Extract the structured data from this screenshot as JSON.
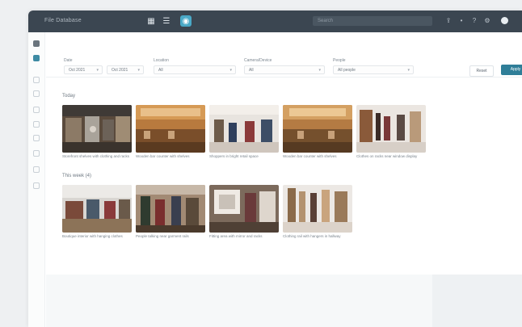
{
  "app": {
    "title": "File Database"
  },
  "toolbar": {
    "search_placeholder": "Search",
    "icons": [
      "grid-icon",
      "list-icon",
      "map-pin-icon"
    ]
  },
  "filters": {
    "date": {
      "label": "Date",
      "value_from": "Oct 2021",
      "value_to": "Oct 2021"
    },
    "location": {
      "label": "Location",
      "value": "All"
    },
    "camera": {
      "label": "Camera/Device",
      "value": "All"
    },
    "people": {
      "label": "People",
      "value": "All people"
    },
    "reset_label": "Reset",
    "apply_label": "Apply"
  },
  "sections": [
    {
      "title": "Today",
      "items": [
        {
          "caption": "Storefront shelves with clothing and racks"
        },
        {
          "caption": "Wooden bar counter with shelves"
        },
        {
          "caption": "Shoppers in bright retail space"
        },
        {
          "caption": "Wooden bar counter with shelves"
        },
        {
          "caption": "Clothes on racks near window display"
        }
      ]
    },
    {
      "title": "This week (4)",
      "items": [
        {
          "caption": "Boutique interior with hanging clothes"
        },
        {
          "caption": "People talking near garment rails"
        },
        {
          "caption": "Fitting area with mirror and racks"
        },
        {
          "caption": "Clothing rail with hangers in hallway"
        }
      ]
    }
  ],
  "colors": {
    "topbar": "#3b4651",
    "accent": "#2f7e98",
    "active_view": "#4aa9c7"
  }
}
